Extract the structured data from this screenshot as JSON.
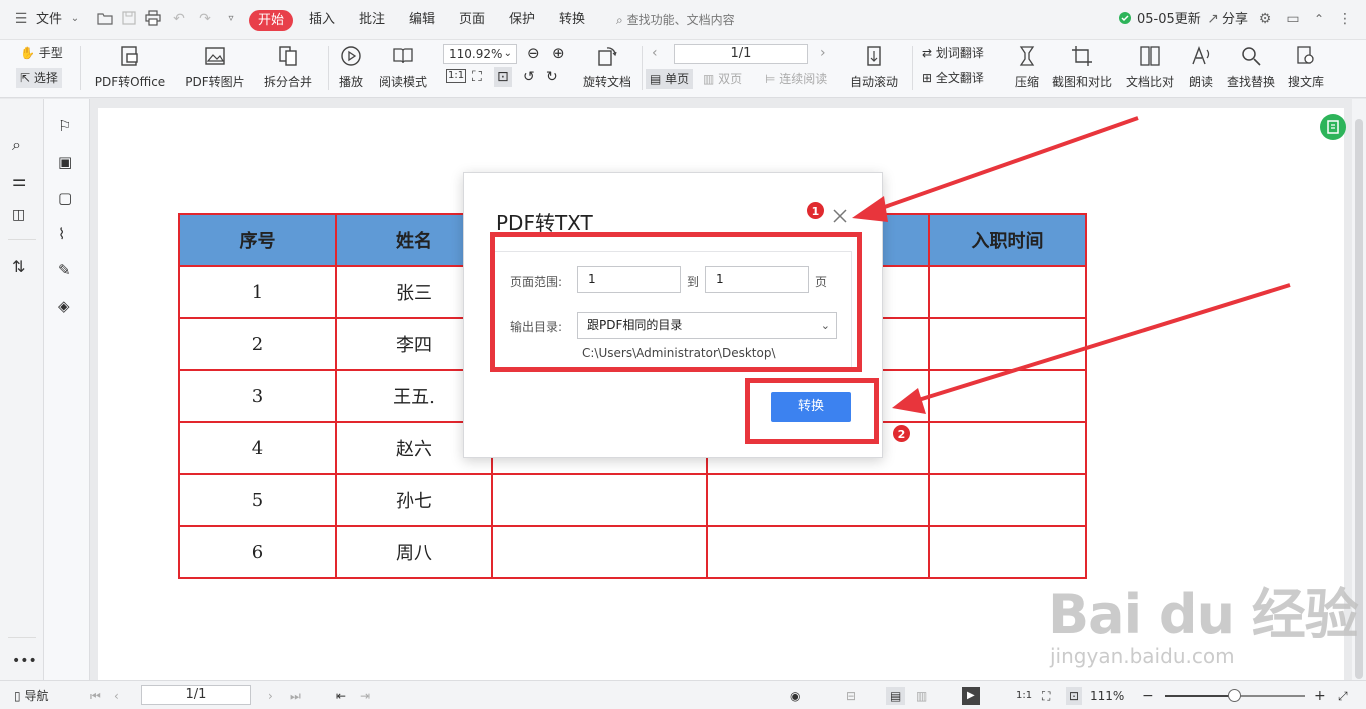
{
  "menubar": {
    "file": "文件",
    "start": "开始",
    "tabs": [
      "插入",
      "批注",
      "编辑",
      "页面",
      "保护",
      "转换"
    ],
    "search": "查找功能、文档内容",
    "update": "05-05更新",
    "share": "分享"
  },
  "ribbon": {
    "hand": "手型",
    "select": "选择",
    "pdf_to_office": "PDF转Office",
    "pdf_to_image": "PDF转图片",
    "split_merge": "拆分合并",
    "play": "播放",
    "read_mode": "阅读模式",
    "zoom": "110.92%",
    "rotate": "旋转文档",
    "page_value": "1/1",
    "single": "单页",
    "double": "双页",
    "continuous": "连续阅读",
    "autoscroll": "自动滚动",
    "word_translate": "划词翻译",
    "full_translate": "全文翻译",
    "compress": "压缩",
    "screenshot_compare": "截图和对比",
    "doc_compare": "文档比对",
    "read_aloud": "朗读",
    "find_replace": "查找替换",
    "search_lib": "搜文库"
  },
  "table": {
    "headers": [
      "序号",
      "姓名",
      "",
      "",
      "入职时间"
    ],
    "rows": [
      [
        "1",
        "张三"
      ],
      [
        "2",
        "李四"
      ],
      [
        "3",
        "王五."
      ],
      [
        "4",
        "赵六"
      ],
      [
        "5",
        "孙七"
      ],
      [
        "6",
        "周八"
      ]
    ]
  },
  "dialog": {
    "title": "PDF转TXT",
    "page_range_label": "页面范围:",
    "from": "1",
    "to_label": "到",
    "to": "1",
    "page_unit": "页",
    "output_label": "输出目录:",
    "output_value": "跟PDF相同的目录",
    "path": "C:\\Users\\Administrator\\Desktop\\",
    "convert": "转换"
  },
  "annotations": {
    "badge1": "1",
    "badge2": "2",
    "color": "#e8353c"
  },
  "watermark": {
    "main": "Bai du 经验",
    "sub": "jingyan.baidu.com"
  },
  "statusbar": {
    "nav": "导航",
    "page": "1/1",
    "zoom": "111%"
  }
}
